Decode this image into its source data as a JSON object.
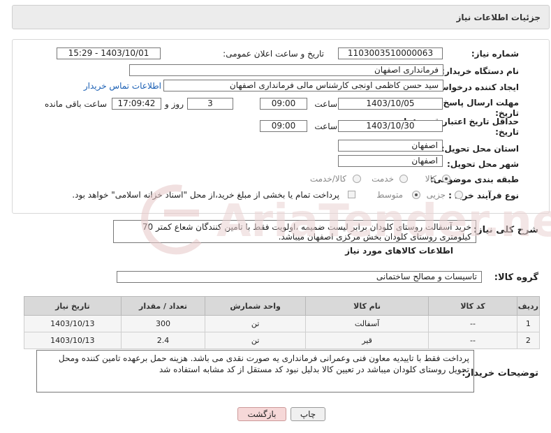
{
  "header": {
    "title": "جزئیات اطلاعات نیاز"
  },
  "form": {
    "need_number_label": "شماره نیاز:",
    "need_number": "1103003510000063",
    "announce_label": "تاریخ و ساعت اعلان عمومی:",
    "announce_value": "1403/10/01 - 15:29",
    "buyer_org_label": "نام دستگاه خریدار:",
    "buyer_org": "فرمانداری اصفهان",
    "creator_label": "ایجاد کننده درخواست:",
    "creator": "سید حسن  کاظمی اونجی کارشناس مالی  فرمانداری اصفهان",
    "contact_link": "اطلاعات تماس خریدار",
    "reply_deadline_label_1": "مهلت ارسال پاسخ: تا",
    "reply_deadline_label_2": "تاریخ:",
    "reply_date": "1403/10/05",
    "time_label": "ساعت",
    "reply_time": "09:00",
    "days_value": "3",
    "days_label": "روز و",
    "remaining_time": "17:09:42",
    "remaining_label": "ساعت باقی مانده",
    "validity_label_1": "حداقل تاریخ اعتبار قیمت: تا",
    "validity_label_2": "تاریخ:",
    "validity_date": "1403/10/30",
    "validity_time": "09:00",
    "province_label": "استان محل تحویل:",
    "province": "اصفهان",
    "city_label": "شهر محل تحویل:",
    "city": "اصفهان",
    "category_label": "طبقه بندی موضوعی:",
    "category_options": [
      "کالا",
      "خدمت",
      "کالا/خدمت"
    ],
    "process_label": "نوع فرآیند خرید :",
    "process_options": [
      "جزیی",
      "متوسط"
    ],
    "process_note": "پرداخت تمام یا بخشی از مبلغ خرید،از محل \"اسناد خزانه اسلامی\" خواهد بود."
  },
  "summary": {
    "label": "شرح کلی نیاز:",
    "text": "خرید آسفالت روستای کلودان برابر لیست ضمیمه ،اولویت فقط با تامین کنندگان شعاع کمتر 70 کیلومتری روستای کلودان بخش مرکزی اصفهان میباشد."
  },
  "goods": {
    "section_title": "اطلاعات کالاهای مورد نیاز",
    "group_label": "گروه کالا:",
    "group_value": "تاسیسات و مصالح ساختمانی",
    "columns": [
      "ردیف",
      "کد کالا",
      "نام کالا",
      "واحد شمارش",
      "تعداد / مقدار",
      "تاریخ نیاز"
    ],
    "rows": [
      [
        "1",
        "--",
        "آسفالت",
        "تن",
        "300",
        "1403/10/13"
      ],
      [
        "2",
        "--",
        "قیر",
        "تن",
        "2.4",
        "1403/10/13"
      ]
    ]
  },
  "notes": {
    "label": "توضیحات خریدار:",
    "text": "پرداخت فقط با تاییدیه معاون فنی وعمرانی فرمانداری یه صورت نقدی می باشد. هزینه حمل برعهده تامین کننده ومحل تحویل روستای کلودان میباشد در تعیین کالا بدلیل نبود کد مستقل  از کد مشابه استفاده شد"
  },
  "buttons": {
    "print": "چاپ",
    "back": "بازگشت"
  },
  "watermark": {
    "text": "AriaTender.net"
  }
}
